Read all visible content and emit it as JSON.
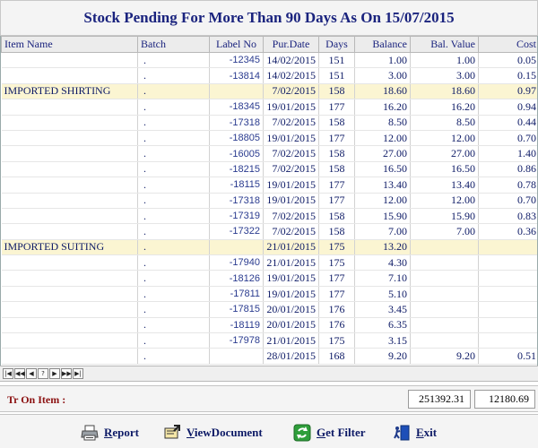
{
  "title": "Stock Pending For More Than 90 Days As On 15/07/2015",
  "columns": {
    "item": "Item Name",
    "batch": "Batch",
    "label": "Label No",
    "date": "Pur.Date",
    "days": "Days",
    "balance": "Balance",
    "value": "Bal. Value",
    "cost": "Cost"
  },
  "rows": [
    {
      "item": "",
      "batch": ".",
      "label": "-12345",
      "date": "14/02/2015",
      "days": "151",
      "balance": "1.00",
      "value": "1.00",
      "cost": "0.05",
      "group": false
    },
    {
      "item": "",
      "batch": ".",
      "label": "-13814",
      "date": "14/02/2015",
      "days": "151",
      "balance": "3.00",
      "value": "3.00",
      "cost": "0.15",
      "group": false
    },
    {
      "item": "IMPORTED SHIRTING",
      "batch": ".",
      "label": "",
      "date": "7/02/2015",
      "days": "158",
      "balance": "18.60",
      "value": "18.60",
      "cost": "0.97",
      "group": true
    },
    {
      "item": "",
      "batch": ".",
      "label": "-18345",
      "date": "19/01/2015",
      "days": "177",
      "balance": "16.20",
      "value": "16.20",
      "cost": "0.94",
      "group": false
    },
    {
      "item": "",
      "batch": ".",
      "label": "-17318",
      "date": "7/02/2015",
      "days": "158",
      "balance": "8.50",
      "value": "8.50",
      "cost": "0.44",
      "group": false
    },
    {
      "item": "",
      "batch": ".",
      "label": "-18805",
      "date": "19/01/2015",
      "days": "177",
      "balance": "12.00",
      "value": "12.00",
      "cost": "0.70",
      "group": false
    },
    {
      "item": "",
      "batch": ".",
      "label": "-16005",
      "date": "7/02/2015",
      "days": "158",
      "balance": "27.00",
      "value": "27.00",
      "cost": "1.40",
      "group": false
    },
    {
      "item": "",
      "batch": ".",
      "label": "-18215",
      "date": "7/02/2015",
      "days": "158",
      "balance": "16.50",
      "value": "16.50",
      "cost": "0.86",
      "group": false
    },
    {
      "item": "",
      "batch": ".",
      "label": "-18115",
      "date": "19/01/2015",
      "days": "177",
      "balance": "13.40",
      "value": "13.40",
      "cost": "0.78",
      "group": false
    },
    {
      "item": "",
      "batch": ".",
      "label": "-17318",
      "date": "19/01/2015",
      "days": "177",
      "balance": "12.00",
      "value": "12.00",
      "cost": "0.70",
      "group": false
    },
    {
      "item": "",
      "batch": ".",
      "label": "-17319",
      "date": "7/02/2015",
      "days": "158",
      "balance": "15.90",
      "value": "15.90",
      "cost": "0.83",
      "group": false
    },
    {
      "item": "",
      "batch": ".",
      "label": "-17322",
      "date": "7/02/2015",
      "days": "158",
      "balance": "7.00",
      "value": "7.00",
      "cost": "0.36",
      "group": false
    },
    {
      "item": "IMPORTED SUITING",
      "batch": ".",
      "label": "",
      "date": "21/01/2015",
      "days": "175",
      "balance": "13.20",
      "value": "",
      "cost": "",
      "group": true
    },
    {
      "item": "",
      "batch": ".",
      "label": "-17940",
      "date": "21/01/2015",
      "days": "175",
      "balance": "4.30",
      "value": "",
      "cost": "",
      "group": false
    },
    {
      "item": "",
      "batch": ".",
      "label": "-18126",
      "date": "19/01/2015",
      "days": "177",
      "balance": "7.10",
      "value": "",
      "cost": "",
      "group": false
    },
    {
      "item": "",
      "batch": ".",
      "label": "-17811",
      "date": "19/01/2015",
      "days": "177",
      "balance": "5.10",
      "value": "",
      "cost": "",
      "group": false
    },
    {
      "item": "",
      "batch": ".",
      "label": "-17815",
      "date": "20/01/2015",
      "days": "176",
      "balance": "3.45",
      "value": "",
      "cost": "",
      "group": false
    },
    {
      "item": "",
      "batch": ".",
      "label": "-18119",
      "date": "20/01/2015",
      "days": "176",
      "balance": "6.35",
      "value": "",
      "cost": "",
      "group": false
    },
    {
      "item": "",
      "batch": ".",
      "label": "-17978",
      "date": "21/01/2015",
      "days": "175",
      "balance": "3.15",
      "value": "",
      "cost": "",
      "group": false
    },
    {
      "item": "",
      "batch": ".",
      "label": "",
      "date": "28/01/2015",
      "days": "168",
      "balance": "9.20",
      "value": "9.20",
      "cost": "0.51",
      "group": false
    }
  ],
  "nav_buttons": [
    {
      "name": "first-page-button",
      "icon": "first-icon",
      "glyph": "|◀"
    },
    {
      "name": "previous-page-button",
      "icon": "previous-page-icon",
      "glyph": "◀◀"
    },
    {
      "name": "previous-record-button",
      "icon": "previous-icon",
      "glyph": "◀"
    },
    {
      "name": "help-button",
      "icon": "question-icon",
      "glyph": "?"
    },
    {
      "name": "next-record-button",
      "icon": "next-icon",
      "glyph": "▶"
    },
    {
      "name": "next-page-button",
      "icon": "next-page-icon",
      "glyph": "▶▶"
    },
    {
      "name": "last-page-button",
      "icon": "last-icon",
      "glyph": "▶|"
    }
  ],
  "totals": {
    "label": "Tr On Item :",
    "balance": "251392.31",
    "value": "12180.69"
  },
  "buttons": {
    "report": "Report",
    "view_document": "ViewDocument",
    "get_filter": "Get Filter",
    "exit": "Exit"
  },
  "colors": {
    "title_text": "#1a237e",
    "group_row_bg": "#fbf5d2",
    "total_label": "#8b1010"
  }
}
